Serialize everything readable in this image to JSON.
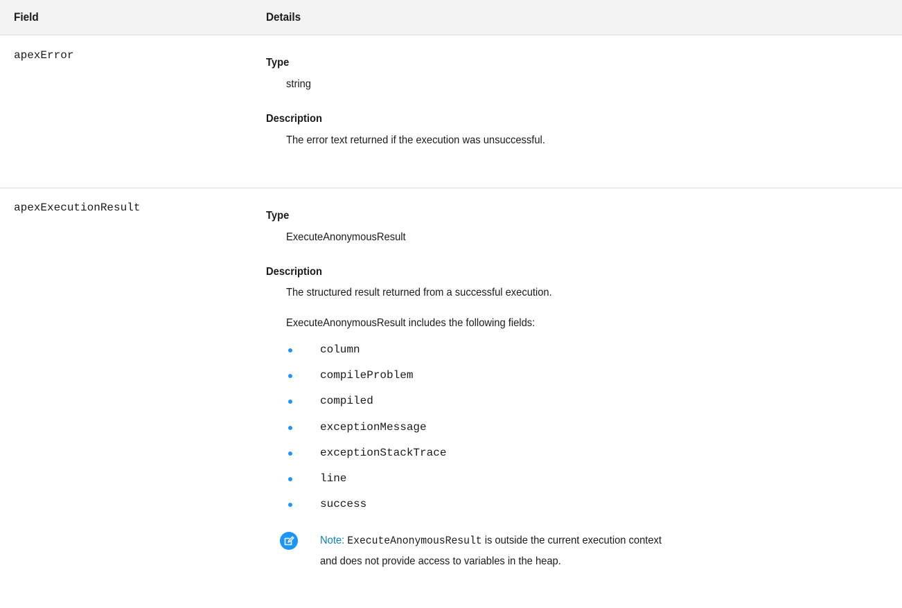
{
  "table": {
    "headers": {
      "field": "Field",
      "details": "Details"
    },
    "rows": [
      {
        "field": "apexError",
        "type_label": "Type",
        "type_value": "string",
        "description_label": "Description",
        "description_text": "The error text returned if the execution was unsuccessful."
      },
      {
        "field": "apexExecutionResult",
        "type_label": "Type",
        "type_value": "ExecuteAnonymousResult",
        "description_label": "Description",
        "description_text": "The structured result returned from a successful execution.",
        "includes_text": "ExecuteAnonymousResult includes the following fields:",
        "fields": [
          "column",
          "compileProblem",
          "compiled",
          "exceptionMessage",
          "exceptionStackTrace",
          "line",
          "success"
        ],
        "note": {
          "icon": "edit-note-icon",
          "label": "Note:",
          "code": "ExecuteAnonymousResult",
          "line1_rest": " is outside the current execution context",
          "line2": "and does not provide access to variables in the heap."
        }
      }
    ]
  },
  "colors": {
    "accent": "#1b96ff",
    "note_label": "#0b82c4",
    "header_bg": "#f3f3f3",
    "divider": "#d8dde6"
  }
}
